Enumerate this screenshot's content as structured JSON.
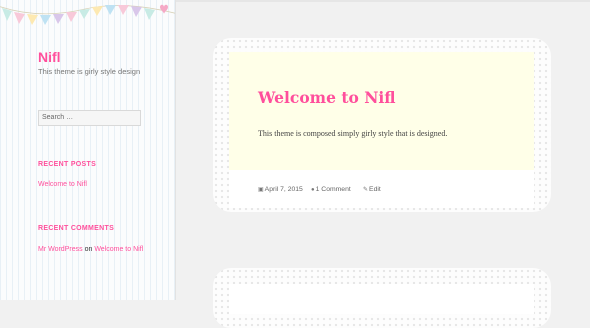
{
  "site": {
    "title": "Nifl",
    "description": "This theme is girly style design"
  },
  "search": {
    "placeholder": "Search …"
  },
  "widgets": {
    "recent_posts": {
      "title": "RECENT POSTS",
      "items": [
        "Welcome to Nifl"
      ]
    },
    "recent_comments": {
      "title": "RECENT COMMENTS",
      "author": "Mr WordPress",
      "on": "on",
      "post": "Welcome to Nifl"
    }
  },
  "post": {
    "title": "Welcome to Nifl",
    "content": "This theme is composed simply girly style that is designed.",
    "date": "April 7, 2015",
    "comments": "1 Comment",
    "edit": "Edit"
  },
  "colors": {
    "accent": "#ff4f9c",
    "header_bg": "#ffffe8",
    "page_bg": "#f1f1f1"
  },
  "icons": {
    "date": "calendar-icon",
    "comments": "comment-bubble-icon",
    "edit": "pencil-icon"
  }
}
